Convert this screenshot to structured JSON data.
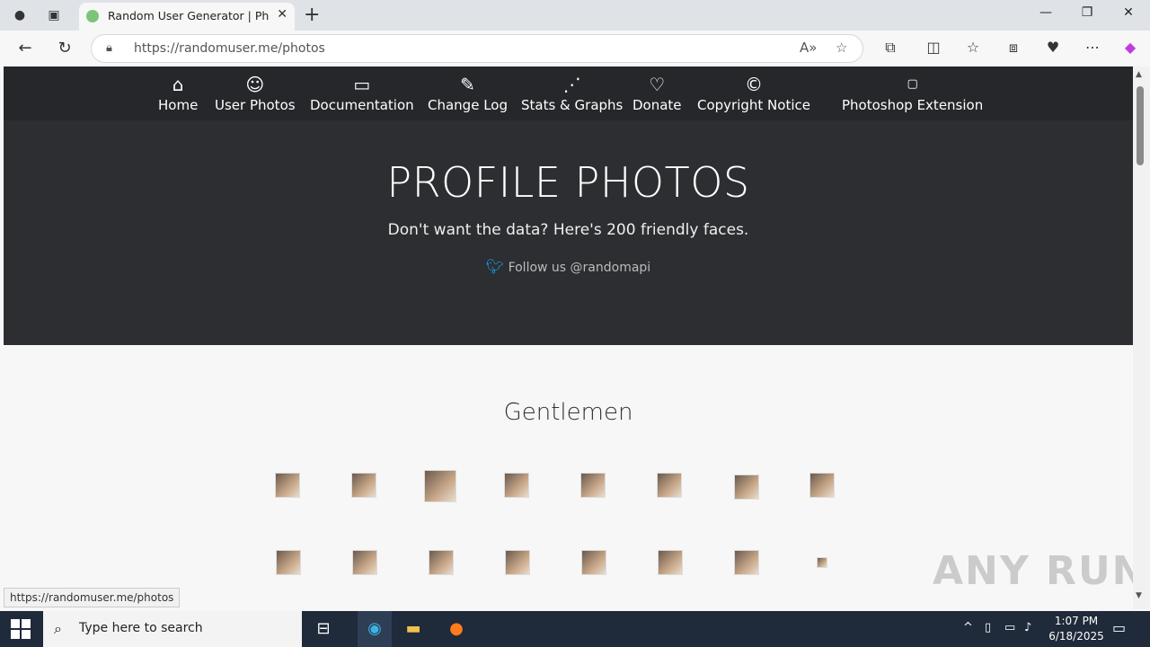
{
  "browser": {
    "tab_title": "Random User Generator | Photos",
    "url": "https://randomuser.me/photos",
    "status_url": "https://randomuser.me/photos"
  },
  "nav": {
    "items": [
      {
        "label": "Home",
        "icon": "home-icon",
        "glyph": "⌂"
      },
      {
        "label": "User Photos",
        "icon": "user-icon",
        "glyph": "☺"
      },
      {
        "label": "Documentation",
        "icon": "book-icon",
        "glyph": "▭"
      },
      {
        "label": "Change Log",
        "icon": "pencil-icon",
        "glyph": "✎"
      },
      {
        "label": "Stats & Graphs",
        "icon": "graph-icon",
        "glyph": "⋰"
      },
      {
        "label": "Donate",
        "icon": "heart-icon",
        "glyph": "♡"
      },
      {
        "label": "Copyright Notice",
        "icon": "copyright-icon",
        "glyph": "©"
      },
      {
        "label": "Photoshop Extension",
        "icon": "photoshop-icon",
        "glyph": "Ps"
      }
    ]
  },
  "hero": {
    "title": "PROFILE PHOTOS",
    "subtitle": "Don't want the data? Here's 200 friendly faces.",
    "twitter": "Follow us @randomapi"
  },
  "section": {
    "title": "Gentlemen"
  },
  "taskbar": {
    "search_placeholder": "Type here to search",
    "time": "1:07 PM",
    "date": "6/18/2025"
  },
  "watermark": "ANY RUN"
}
